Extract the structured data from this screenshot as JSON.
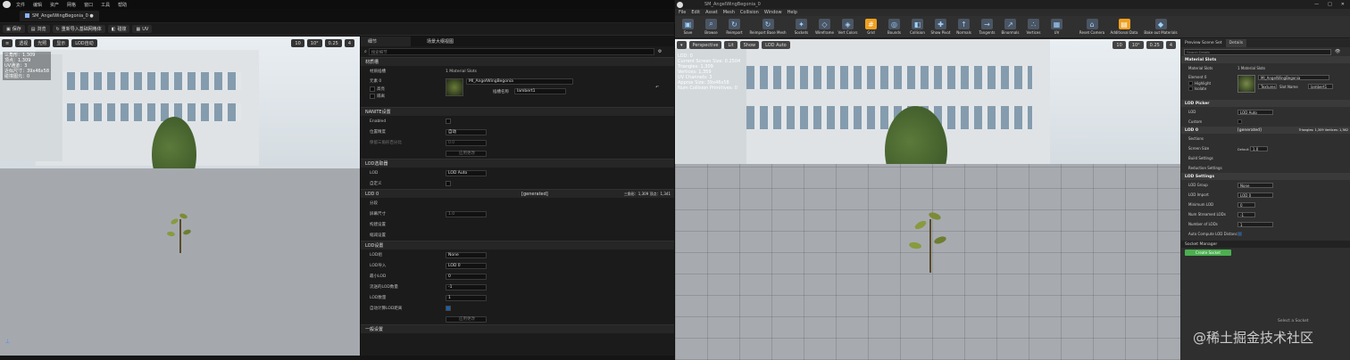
{
  "left": {
    "menu": [
      "文件",
      "编辑",
      "资产",
      "网格",
      "窗口",
      "工具",
      "帮助"
    ],
    "tab_title": "SM_AngelWingBegonia_0 ●",
    "toolbar": {
      "save": "保存",
      "browse": "浏览",
      "reimport": "重新导入基础网格体",
      "collision": "碰撞",
      "uv": "UV"
    },
    "viewport_toolbar": {
      "perspective": "透视",
      "lit": "光照",
      "show": "显示",
      "lod": "LOD自动",
      "grid": "10",
      "angle": "10°",
      "scale": "0.25",
      "speed": "4"
    },
    "stats": [
      "三角形：1,309",
      "顶点：1,309",
      "UV通道：3",
      "近似尺寸：39x46x58",
      "碰撞图元：0"
    ],
    "details": {
      "tabs": [
        "细节",
        "场景大纲视图"
      ],
      "search_placeholder": "搜索细节",
      "sections": {
        "material_slots": "材质槽",
        "nanite": "NANITE设置",
        "lod_picker": "LOD选取器",
        "lod0": "LOD 0",
        "lod_settings": "LOD设置",
        "general": "一般设置"
      },
      "material_slots_label": "材质插槽",
      "material_slots_value": "1 Material Slots",
      "element_label": "元素 0",
      "highlight_label": "高亮",
      "isolate_label": "隔离",
      "material_name": "MI_AngelWingBegonia",
      "slot_name_label": "插槽名称",
      "slot_name_value": "lambert1",
      "nanite_enabled": "Enabled",
      "position_precision": "位置精度",
      "position_precision_value": "自动",
      "keep_triangle": "保留三角形百分比",
      "keep_triangle_value": "0.0",
      "apply_changes": "应用更改",
      "lod_label": "LOD",
      "lod_value": "LOD Auto",
      "custom_label": "自定义",
      "lod0_generated": "[generated]",
      "lod0_stats": "三角形：1,309  顶点：1,341",
      "sections_label": "分段",
      "screen_size_label": "屏幕尺寸",
      "screen_size_value": "1.0",
      "build_settings": "构建设置",
      "reduction_settings": "缩减设置",
      "lod_group_label": "LOD组",
      "lod_group_value": "None",
      "lod_import_label": "LOD导入",
      "lod_import_value": "LOD 0",
      "min_lod_label": "最小LOD",
      "min_lod_value": "0",
      "num_streamed_label": "流送的LOD数量",
      "num_streamed_value": "-1",
      "num_lods_label": "LOD数量",
      "num_lods_value": "1",
      "auto_compute_label": "自动计算LOD距离"
    }
  },
  "right": {
    "title": "SM_AngelWingBegonia_0",
    "menu": [
      "File",
      "Edit",
      "Asset",
      "Mesh",
      "Collision",
      "Window",
      "Help"
    ],
    "toolbar": [
      "Save",
      "Browse",
      "Reimport",
      "Reimport Base Mesh",
      "Sockets",
      "Wireframe",
      "Vert Colors",
      "Grid",
      "Bounds",
      "Collision",
      "Show Pivot",
      "Normals",
      "Tangents",
      "Binormals",
      "Vertices",
      "UV",
      "Reset Camera",
      "Additional Data",
      "Bake out Materials"
    ],
    "viewport_toolbar": {
      "perspective": "Perspective",
      "lit": "Lit",
      "show": "Show",
      "lod": "LOD Auto",
      "grid": "10",
      "angle": "10°",
      "scale": "0.25",
      "speed": "4"
    },
    "stats": [
      "LOD: 0",
      "Current Screen Size: 0.2504",
      "Triangles: 1,309",
      "Vertices: 1,359",
      "UV Channels: 3",
      "Approx Size: 39x46x58",
      "Num Collision Primitives: 0"
    ],
    "details": {
      "tabs": [
        "Preview Scene Set",
        "Details"
      ],
      "search_placeholder": "Search Details",
      "material_slots_header": "Material Slots",
      "material_slots_label": "Material Slots",
      "material_slots_value": "1 Material Slots",
      "element_label": "Element 0",
      "highlight_label": "Highlight",
      "isolate_label": "Isolate",
      "material_name": "MI_AngelWingBegonia",
      "textures_label": "Textures",
      "slot_name_label": "Slot Name",
      "slot_name_value": "lambert1",
      "lod_picker_header": "LOD Picker",
      "lod_label": "LOD",
      "lod_value": "LOD Auto",
      "custom_label": "Custom",
      "lod0_header": "LOD 0",
      "lod0_generated": "[generated]",
      "lod0_stats": "Triangles: 1,309  Vertices: 1,362",
      "sections_label": "Sections",
      "screen_size_label": "Screen Size",
      "default_label": "Default",
      "screen_size_value": "1.0",
      "build_settings": "Build Settings",
      "reduction_settings": "Reduction Settings",
      "lod_settings_header": "LOD Settings",
      "lod_group_label": "LOD Group",
      "lod_group_value": "None",
      "lod_import_label": "LOD Import",
      "lod_import_value": "LOD 0",
      "min_lod_label": "Minimum LOD",
      "min_lod_value": "0",
      "num_streamed_label": "Num Streamed LODs",
      "num_streamed_value": "-1",
      "num_lods_label": "Number of LODs",
      "num_lods_value": "1",
      "auto_compute_label": "Auto Compute LOD Distances",
      "socket_manager": "Socket Manager",
      "create_socket": "Create Socket",
      "select_socket": "Select a Socket"
    }
  },
  "watermark": "@稀土掘金技术社区"
}
